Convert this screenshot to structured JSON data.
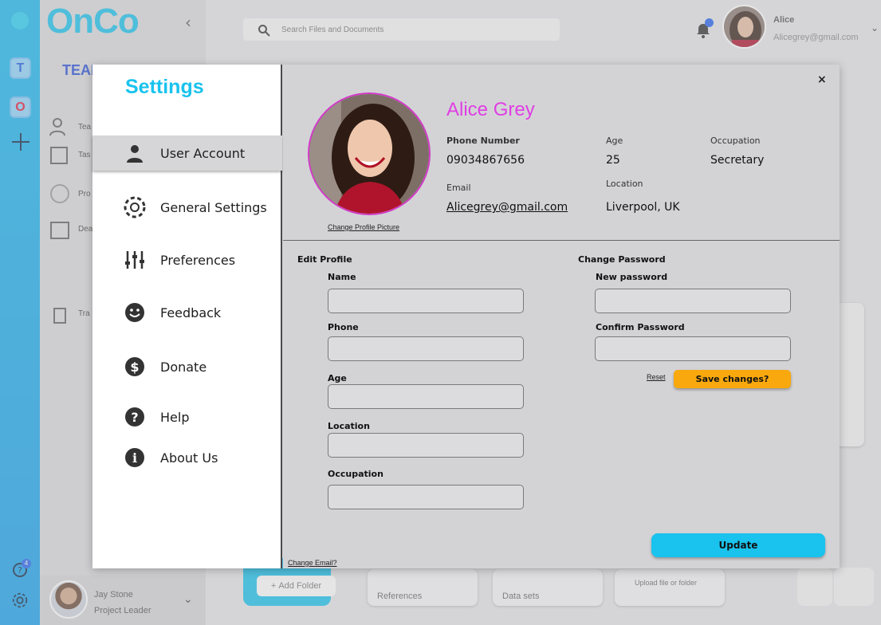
{
  "app": {
    "logo": "OnCo",
    "team_label": "TEAM NAME",
    "rail": {
      "tile_t": "T",
      "tile_o": "O",
      "help_badge": "4"
    },
    "nav_partial": [
      "Tea",
      "Tas",
      "Pro",
      "Dea",
      "Tra"
    ],
    "footer_user": {
      "name": "Jay Stone",
      "role": "Project Leader"
    }
  },
  "topbar": {
    "search_placeholder": "Search Files and Documents",
    "user_name": "Alice",
    "user_email": "Alicegrey@gmail.com"
  },
  "bottom": {
    "add_folder": "Add Folder",
    "cards": [
      "References",
      "Data sets",
      "Upload file or folder"
    ]
  },
  "settings": {
    "title": "Settings",
    "menu": [
      {
        "label": "User Account",
        "icon": "person-icon",
        "active": true
      },
      {
        "label": "General Settings",
        "icon": "gear-icon",
        "active": false
      },
      {
        "label": "Preferences",
        "icon": "sliders-icon",
        "active": false
      },
      {
        "label": "Feedback",
        "icon": "smiley-icon",
        "active": false
      },
      {
        "label": "Donate",
        "icon": "dollar-icon",
        "active": false
      },
      {
        "label": "Help",
        "icon": "question-icon",
        "active": false
      },
      {
        "label": "About Us",
        "icon": "info-icon",
        "active": false
      }
    ],
    "profile": {
      "name": "Alice Grey",
      "change_picture": "Change Profile Picture",
      "phone_label": "Phone Number",
      "phone": "09034867656",
      "age_label": "Age",
      "age": "25",
      "occupation_label": "Occupation",
      "occupation": "Secretary",
      "email_label": "Email",
      "email": "Alicegrey@gmail.com",
      "location_label": "Location",
      "location": "Liverpool, UK"
    },
    "edit_profile": {
      "title": "Edit Profile",
      "fields": [
        "Name",
        "Phone",
        "Age",
        "Location",
        "Occupation"
      ]
    },
    "change_password": {
      "title": "Change Password",
      "new_label": "New password",
      "confirm_label": "Confirm Password",
      "reset": "Reset",
      "save": "Save changes?"
    },
    "update": "Update",
    "change_email": "Change Email?",
    "close": "×"
  }
}
